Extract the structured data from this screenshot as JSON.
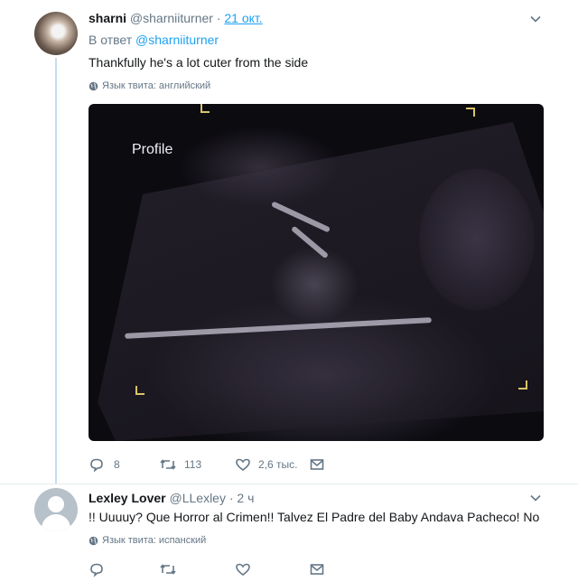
{
  "tweet1": {
    "name": "sharni",
    "handle": "@sharniiturner",
    "dot": "·",
    "time": "21 окт.",
    "reply_prefix": "В ответ",
    "reply_mention": "@sharniiturner",
    "text": "Thankfully he's a lot cuter from the side",
    "lang": "Язык твита: английский",
    "media_label": "Profile",
    "actions": {
      "reply_count": "8",
      "retweet_count": "113",
      "like_count": "2,6 тыс."
    }
  },
  "tweet2": {
    "name": "Lexley Lover",
    "handle": "@LLexley",
    "dot": "·",
    "time": "2 ч",
    "text": "!! Uuuuy? Que Horror al Crimen!! Talvez El Padre del Baby Andava Pacheco! No",
    "lang": "Язык твита: испанский"
  },
  "icons": [
    "chevron-down-icon",
    "globe-icon",
    "reply-icon",
    "retweet-icon",
    "like-icon",
    "direct-message-icon"
  ],
  "colors": {
    "accent": "#1da1f2",
    "muted": "#657786",
    "thread": "#c4ddf0"
  }
}
